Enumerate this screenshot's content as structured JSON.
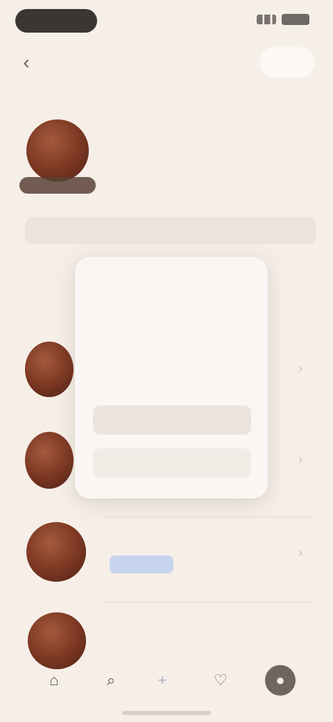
{
  "status_bar": {
    "signal_icon": "signal-icon",
    "battery_icon": "battery-icon"
  },
  "header": {
    "back_icon": "‹",
    "title": "",
    "action_label": ""
  },
  "profile": {
    "name": "",
    "subtitle": ""
  },
  "info_bar": {
    "text": ""
  },
  "section": {
    "label": ""
  },
  "popup": {
    "title": "",
    "lines": [
      "",
      "",
      "",
      ""
    ],
    "primary_label": "",
    "danger_label": ""
  },
  "rows": {
    "row3_text": "",
    "row3_link": "",
    "row4_text": ""
  },
  "tabbar": {
    "home": "⌂",
    "search": "⌕",
    "add": "+",
    "heart": "♡",
    "profile": "●"
  }
}
